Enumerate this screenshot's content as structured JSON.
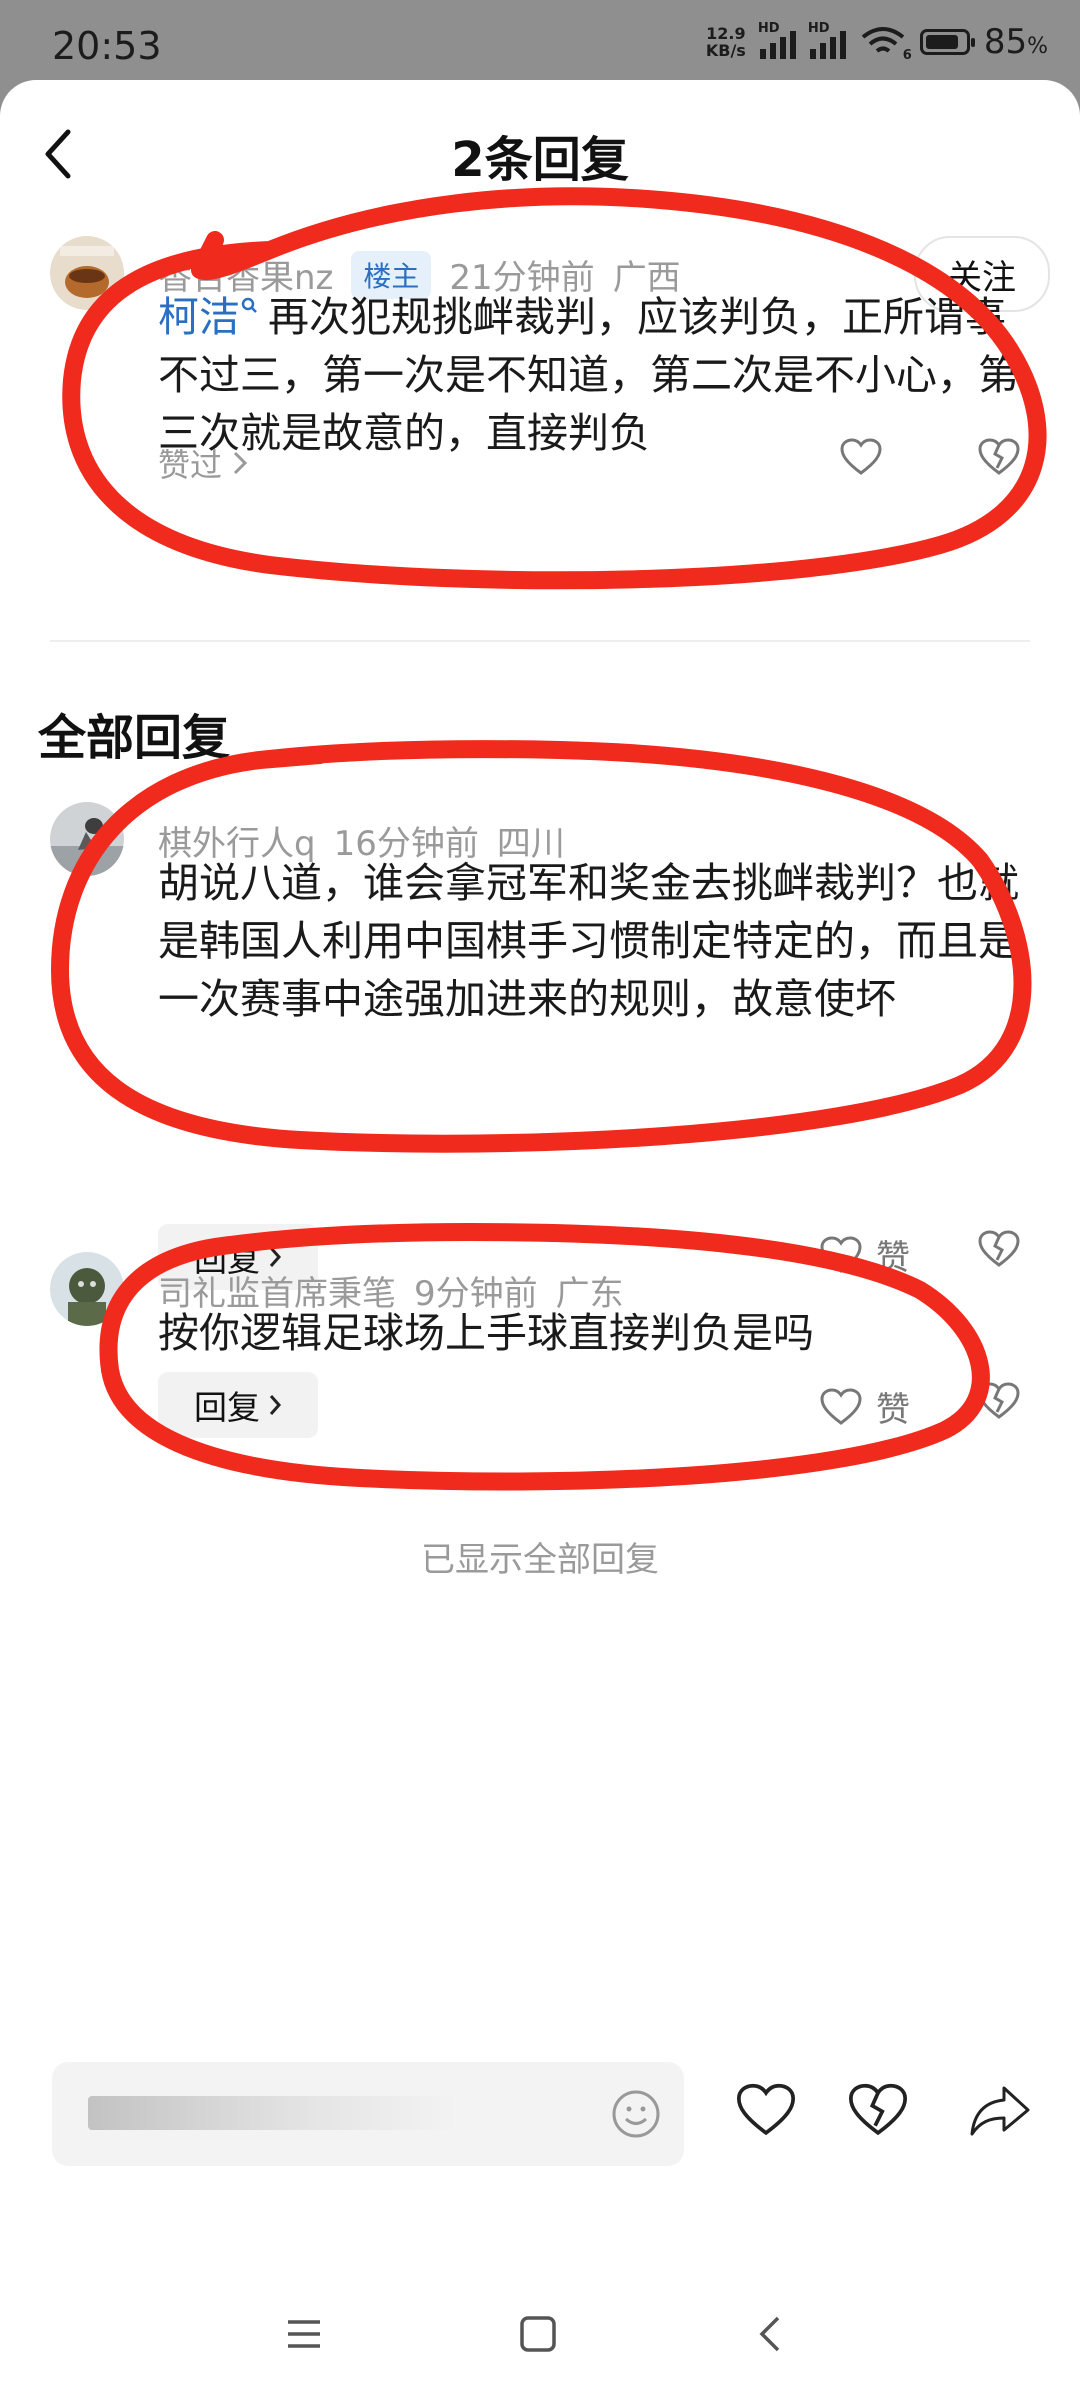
{
  "status_bar": {
    "time": "20:53",
    "net_speed_value": "12.9",
    "net_speed_unit": "KB/s",
    "sim1_label": "HD",
    "sim2_label": "HD",
    "wifi_badge": "6",
    "battery_percent": 85,
    "battery_text": "85",
    "battery_pct_sign": "%"
  },
  "header": {
    "title": "2条回复"
  },
  "root_comment": {
    "username": "香百香果nz",
    "op_badge": "楼主",
    "time": "21分钟前",
    "location": "广西",
    "follow_label": "关注",
    "mention": "柯洁",
    "text": "再次犯规挑衅裁判，应该判负，正所谓事不过三，第一次是不知道，第二次是不小心，第三次就是故意的，直接判负",
    "liked_by": "赞过"
  },
  "section": {
    "title": "全部回复"
  },
  "replies": [
    {
      "username": "棋外行人q",
      "time": "16分钟前",
      "location": "四川",
      "text": "胡说八道，谁会拿冠军和奖金去挑衅裁判？也就是韩国人利用中国棋手习惯制定特定的，而且是一次赛事中途强加进来的规则，故意使坏",
      "reply_label": "回复",
      "like_label": "赞"
    },
    {
      "username": "司礼监首席秉笔",
      "time": "9分钟前",
      "location": "广东",
      "text": "按你逻辑足球场上手球直接判负是吗",
      "reply_label": "回复",
      "like_label": "赞"
    }
  ],
  "footer": {
    "all_shown": "已显示全部回复"
  },
  "icons": {
    "back": "chevron-left-icon",
    "heart": "heart-outline-icon",
    "broken_heart": "broken-heart-icon",
    "share": "share-arrow-icon",
    "emoji": "emoji-smile-icon",
    "search_hint": "search-icon"
  },
  "colors": {
    "link_blue": "#2a6fc1",
    "scribble_red": "#f02a1c",
    "muted_gray": "#9a9a9a"
  }
}
